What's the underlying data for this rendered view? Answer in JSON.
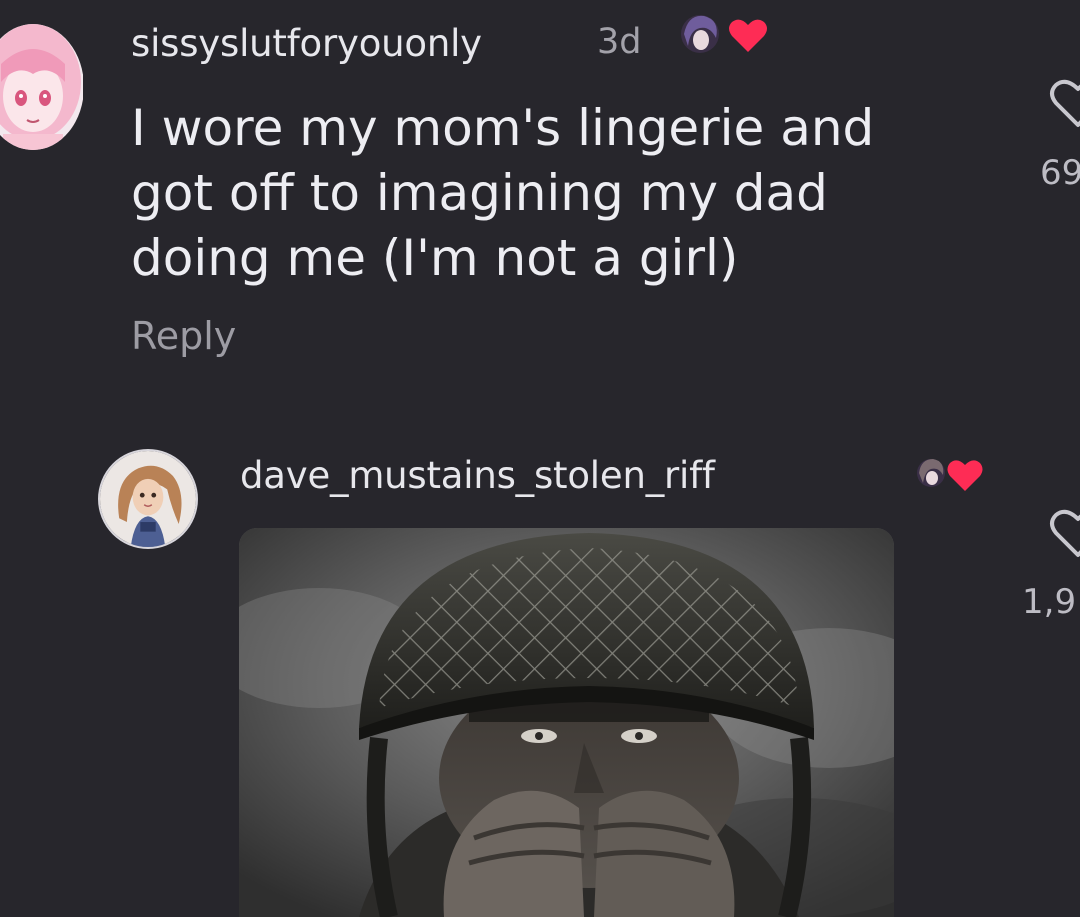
{
  "comments": [
    {
      "username": "sissyslutforyouonly",
      "timestamp": "3d",
      "text": "I wore my mom's lingerie and\ngot off to imagining my dad\ndoing me (I'm not a girl)",
      "reply_label": "Reply",
      "like_count": "69",
      "avatar_icon": "anime-avatar",
      "creator_liked": true
    },
    {
      "username": "dave_mustains_stolen_riff",
      "like_count": "1,9",
      "avatar_icon": "doll-avatar",
      "creator_liked": true,
      "attachment_icon": "soldier-photo"
    }
  ],
  "icons": {
    "like": "heart-outline-icon",
    "creator_like": "heart-filled-icon"
  },
  "colors": {
    "background": "#27262c",
    "text_primary": "#ececf0",
    "text_secondary": "#a3a2aa",
    "heart_accent": "#fe2c55"
  }
}
